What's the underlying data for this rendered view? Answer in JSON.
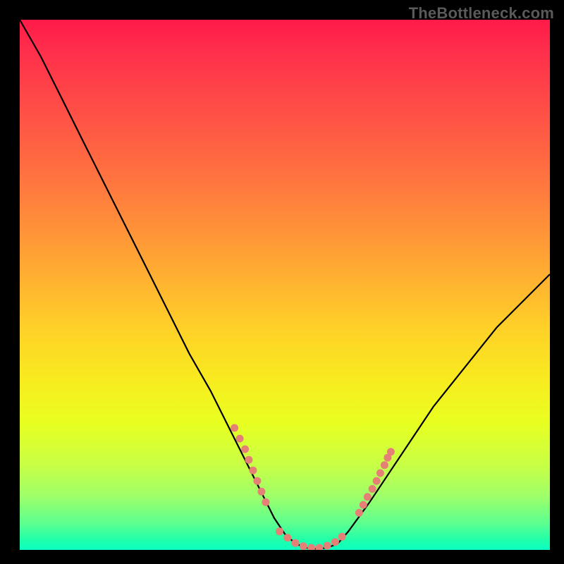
{
  "watermark_text": "TheBottleneck.com",
  "chart_data": {
    "type": "line",
    "title": "",
    "xlabel": "",
    "ylabel": "",
    "xlim": [
      0,
      100
    ],
    "ylim": [
      0,
      100
    ],
    "grid": false,
    "legend": "none",
    "series": [
      {
        "name": "bottleneck-curve",
        "x": [
          0,
          4,
          8,
          12,
          16,
          20,
          24,
          28,
          32,
          36,
          40,
          44,
          46,
          48,
          50,
          52,
          54,
          56,
          58,
          60,
          62,
          66,
          70,
          74,
          78,
          82,
          86,
          90,
          94,
          98,
          100
        ],
        "y": [
          100,
          93,
          85,
          77,
          69,
          61,
          53,
          45,
          37,
          30,
          22,
          14,
          10,
          6,
          3,
          1.2,
          0.4,
          0.2,
          0.4,
          1.2,
          3.5,
          9,
          15,
          21,
          27,
          32,
          37,
          42,
          46,
          50,
          52
        ]
      }
    ],
    "dotted_segments": [
      {
        "name": "left-dotted-segment",
        "color": "#e58077",
        "points": [
          {
            "x": 40.5,
            "y": 23
          },
          {
            "x": 41.5,
            "y": 21
          },
          {
            "x": 42.5,
            "y": 19
          },
          {
            "x": 43.2,
            "y": 17
          },
          {
            "x": 44.0,
            "y": 15
          },
          {
            "x": 44.8,
            "y": 13
          },
          {
            "x": 45.6,
            "y": 11
          },
          {
            "x": 46.4,
            "y": 9
          }
        ]
      },
      {
        "name": "bottom-dotted-segment",
        "color": "#e58077",
        "points": [
          {
            "x": 49.0,
            "y": 3.5
          },
          {
            "x": 50.5,
            "y": 2.3
          },
          {
            "x": 52.0,
            "y": 1.3
          },
          {
            "x": 53.5,
            "y": 0.7
          },
          {
            "x": 55.0,
            "y": 0.4
          },
          {
            "x": 56.5,
            "y": 0.4
          },
          {
            "x": 58.0,
            "y": 0.8
          },
          {
            "x": 59.5,
            "y": 1.5
          },
          {
            "x": 60.8,
            "y": 2.5
          }
        ]
      },
      {
        "name": "right-dotted-segment",
        "color": "#e58077",
        "points": [
          {
            "x": 64.0,
            "y": 7.0
          },
          {
            "x": 64.8,
            "y": 8.5
          },
          {
            "x": 65.6,
            "y": 10.0
          },
          {
            "x": 66.5,
            "y": 11.5
          },
          {
            "x": 67.3,
            "y": 13.0
          },
          {
            "x": 68.0,
            "y": 14.5
          },
          {
            "x": 68.8,
            "y": 16.0
          },
          {
            "x": 69.4,
            "y": 17.4
          },
          {
            "x": 70.0,
            "y": 18.5
          }
        ]
      }
    ]
  },
  "colors": {
    "dot": "#e58077",
    "curve": "#000000",
    "background": "#000000"
  }
}
